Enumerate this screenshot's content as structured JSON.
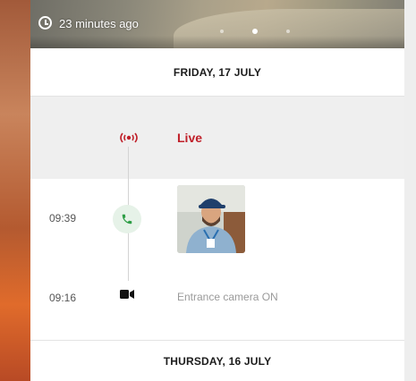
{
  "hero": {
    "time_ago": "23 minutes ago",
    "dots": [
      {
        "active": false
      },
      {
        "active": true
      },
      {
        "active": false
      }
    ]
  },
  "timeline": {
    "date_header_1": "FRIDAY, 17 JULY",
    "live": {
      "icon": "broadcast-icon",
      "label": "Live"
    },
    "events": [
      {
        "time": "09:39",
        "icon": "phone-icon",
        "thumbnail": "visitor-snapshot"
      },
      {
        "time": "09:16",
        "icon": "video-camera-icon",
        "text": "Entrance camera ON"
      }
    ],
    "date_header_2": "THURSDAY, 16 JULY"
  },
  "colors": {
    "accent_red": "#c0202a",
    "call_green": "#2e9e46",
    "live_bg": "#efefef"
  }
}
